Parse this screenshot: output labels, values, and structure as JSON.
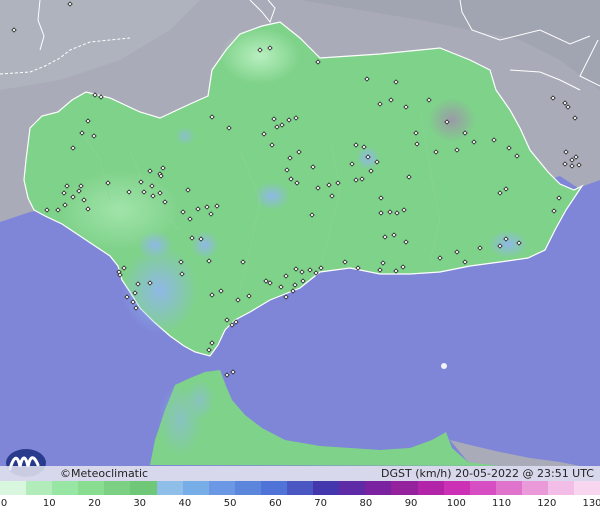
{
  "footer": {
    "credit": "©Meteoclimatic",
    "title": "DGST (km/h)   20-05-2022 @ 23:51 UTC"
  },
  "legend": {
    "ticks": [
      "0",
      "10",
      "20",
      "30",
      "40",
      "50",
      "60",
      "70",
      "80",
      "90",
      "100",
      "110",
      "120",
      "130"
    ],
    "colors": [
      "#d9f7de",
      "#b2ecbb",
      "#98e6a3",
      "#88dd91",
      "#7cd084",
      "#6fc778",
      "#8fbfe8",
      "#78aee8",
      "#6b98e4",
      "#5c86dc",
      "#4f73d6",
      "#4a56c2",
      "#4436ad",
      "#5e2aa6",
      "#7a22a0",
      "#94229c",
      "#b224a8",
      "#cc30b4",
      "#d64ec2",
      "#e074cc",
      "#ea9ad8",
      "#f2bde6",
      "#f8d6f0"
    ]
  },
  "colors": {
    "sea": "#7f86d8",
    "land_gray": "#a9acb8",
    "wind_green": "#7fd28a",
    "wind_blue": "#8fb8e6"
  },
  "stations": [
    [
      14,
      30
    ],
    [
      70,
      4
    ],
    [
      270,
      48
    ],
    [
      260,
      50
    ],
    [
      318,
      62
    ],
    [
      367,
      79
    ],
    [
      396,
      82
    ],
    [
      429,
      100
    ],
    [
      447,
      122
    ],
    [
      465,
      133
    ],
    [
      457,
      150
    ],
    [
      474,
      142
    ],
    [
      494,
      140
    ],
    [
      509,
      148
    ],
    [
      517,
      156
    ],
    [
      553,
      98
    ],
    [
      565,
      103
    ],
    [
      568,
      107
    ],
    [
      575,
      118
    ],
    [
      566,
      152
    ],
    [
      572,
      160
    ],
    [
      576,
      157
    ],
    [
      565,
      164
    ],
    [
      572,
      166
    ],
    [
      579,
      165
    ],
    [
      82,
      133
    ],
    [
      88,
      121
    ],
    [
      94,
      136
    ],
    [
      95,
      95
    ],
    [
      101,
      97
    ],
    [
      73,
      148
    ],
    [
      67,
      186
    ],
    [
      64,
      193
    ],
    [
      73,
      197
    ],
    [
      65,
      205
    ],
    [
      58,
      210
    ],
    [
      47,
      210
    ],
    [
      81,
      186
    ],
    [
      79,
      191
    ],
    [
      84,
      200
    ],
    [
      88,
      209
    ],
    [
      108,
      183
    ],
    [
      129,
      192
    ],
    [
      141,
      182
    ],
    [
      150,
      171
    ],
    [
      152,
      186
    ],
    [
      160,
      193
    ],
    [
      160,
      174
    ],
    [
      153,
      196
    ],
    [
      144,
      192
    ],
    [
      165,
      202
    ],
    [
      163,
      168
    ],
    [
      161,
      176
    ],
    [
      188,
      190
    ],
    [
      183,
      212
    ],
    [
      190,
      219
    ],
    [
      198,
      209
    ],
    [
      207,
      207
    ],
    [
      211,
      214
    ],
    [
      217,
      206
    ],
    [
      212,
      117
    ],
    [
      229,
      128
    ],
    [
      274,
      119
    ],
    [
      277,
      127
    ],
    [
      282,
      125
    ],
    [
      289,
      120
    ],
    [
      296,
      118
    ],
    [
      264,
      134
    ],
    [
      272,
      145
    ],
    [
      290,
      158
    ],
    [
      299,
      152
    ],
    [
      287,
      170
    ],
    [
      291,
      179
    ],
    [
      297,
      183
    ],
    [
      313,
      167
    ],
    [
      329,
      185
    ],
    [
      338,
      183
    ],
    [
      332,
      196
    ],
    [
      318,
      188
    ],
    [
      312,
      215
    ],
    [
      356,
      145
    ],
    [
      364,
      147
    ],
    [
      368,
      157
    ],
    [
      371,
      171
    ],
    [
      377,
      162
    ],
    [
      352,
      164
    ],
    [
      356,
      180
    ],
    [
      362,
      179
    ],
    [
      381,
      198
    ],
    [
      381,
      213
    ],
    [
      390,
      212
    ],
    [
      397,
      213
    ],
    [
      404,
      210
    ],
    [
      394,
      235
    ],
    [
      385,
      237
    ],
    [
      406,
      242
    ],
    [
      417,
      144
    ],
    [
      416,
      133
    ],
    [
      436,
      152
    ],
    [
      409,
      177
    ],
    [
      500,
      193
    ],
    [
      506,
      189
    ],
    [
      559,
      198
    ],
    [
      554,
      211
    ],
    [
      519,
      243
    ],
    [
      506,
      239
    ],
    [
      500,
      246
    ],
    [
      480,
      248
    ],
    [
      465,
      262
    ],
    [
      440,
      258
    ],
    [
      457,
      252
    ],
    [
      403,
      267
    ],
    [
      396,
      271
    ],
    [
      383,
      263
    ],
    [
      380,
      270
    ],
    [
      358,
      268
    ],
    [
      345,
      262
    ],
    [
      321,
      268
    ],
    [
      310,
      270
    ],
    [
      316,
      273
    ],
    [
      302,
      272
    ],
    [
      296,
      269
    ],
    [
      286,
      276
    ],
    [
      295,
      285
    ],
    [
      303,
      281
    ],
    [
      281,
      287
    ],
    [
      293,
      291
    ],
    [
      266,
      281
    ],
    [
      286,
      297
    ],
    [
      270,
      283
    ],
    [
      221,
      291
    ],
    [
      212,
      295
    ],
    [
      238,
      300
    ],
    [
      249,
      296
    ],
    [
      243,
      262
    ],
    [
      209,
      261
    ],
    [
      201,
      239
    ],
    [
      192,
      238
    ],
    [
      182,
      274
    ],
    [
      181,
      262
    ],
    [
      150,
      283
    ],
    [
      138,
      284
    ],
    [
      135,
      293
    ],
    [
      133,
      302
    ],
    [
      127,
      297
    ],
    [
      136,
      308
    ],
    [
      124,
      268
    ],
    [
      119,
      272
    ],
    [
      120,
      275
    ],
    [
      227,
      320
    ],
    [
      236,
      322
    ],
    [
      232,
      325
    ],
    [
      209,
      350
    ],
    [
      212,
      343
    ],
    [
      233,
      372
    ],
    [
      227,
      375
    ],
    [
      380,
      104
    ],
    [
      391,
      100
    ],
    [
      406,
      107
    ]
  ]
}
